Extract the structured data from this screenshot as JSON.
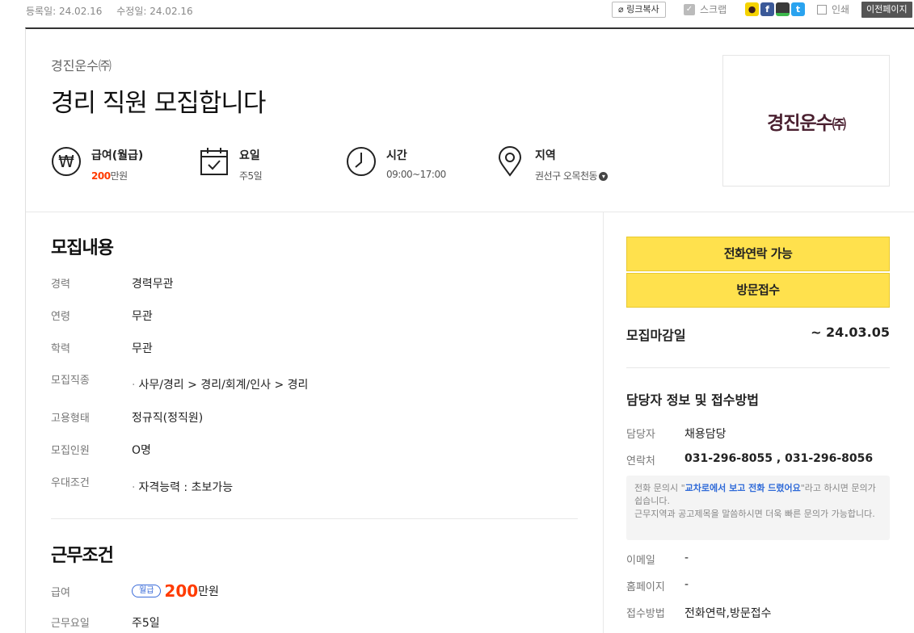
{
  "meta": {
    "registered": "등록일: 24.02.16",
    "modified": "수정일: 24.02.16",
    "link_copy": "링크복사",
    "scrap": "스크랩",
    "print": "인쇄",
    "prev_page": "이전페이지"
  },
  "social": [
    {
      "name": "kakaotalk",
      "color": "#f5d300"
    },
    {
      "name": "facebook",
      "color": "#3b5998"
    },
    {
      "name": "band",
      "color": "#3a3a3a"
    },
    {
      "name": "twitter",
      "color": "#2aa3ef"
    }
  ],
  "header": {
    "company": "경진운수㈜",
    "title": "경리 직원 모집합니다"
  },
  "summary": {
    "pay": {
      "title": "급여(월급)",
      "value": "200",
      "unit": "만원",
      "icon": "won-icon"
    },
    "days": {
      "title": "요일",
      "value": "주5일",
      "icon": "calendar-icon"
    },
    "time": {
      "title": "시간",
      "value": "09:00~17:00",
      "icon": "clock-icon"
    },
    "area": {
      "title": "지역",
      "value": "권선구 오목천동",
      "icon": "location-pin-icon"
    }
  },
  "logo": {
    "text": "경진운수",
    "suffix": "㈜"
  },
  "recruit": {
    "heading": "모집내용",
    "rows": [
      {
        "label": "경력",
        "value": "경력무관"
      },
      {
        "label": "연령",
        "value": "무관"
      },
      {
        "label": "학력",
        "value": "무관"
      },
      {
        "label": "모집직종",
        "value": "사무/경리 > 경리/회계/인사 > 경리"
      },
      {
        "label": "고용형태",
        "value": "정규직(정직원)"
      },
      {
        "label": "모집인원",
        "value": "O명"
      },
      {
        "label": "우대조건",
        "value": "자격능력 : 초보가능"
      }
    ]
  },
  "work": {
    "heading": "근무조건",
    "pay_label": "급여",
    "pay_badge": "월급",
    "pay_amount": "200",
    "pay_unit": "만원",
    "days_label": "근무요일",
    "days_value": "주5일"
  },
  "side": {
    "phone_btn": "전화연락 가능",
    "visit_btn": "방문접수",
    "deadline_label": "모집마감일",
    "deadline_value": "~ 24.03.05",
    "contact_heading": "담당자 정보 및 접수방법",
    "manager_label": "담당자",
    "manager_value": "채용담당",
    "phone_label": "연락처",
    "phone_value": "031-296-8055 , 031-296-8056",
    "note_pre": "전화 문의시 \"",
    "note_hl": "교차로에서 보고 전화 드렸어요",
    "note_post": "\"라고 하시면 문의가 쉽습니다.",
    "note_line2": "근무지역과 공고제목을 말씀하시면 더욱 빠른 문의가 가능합니다.",
    "email_label": "이메일",
    "email_value": "-",
    "homepage_label": "홈페이지",
    "homepage_value": "-",
    "method_label": "접수방법",
    "method_value": "전화연락,방문접수"
  }
}
